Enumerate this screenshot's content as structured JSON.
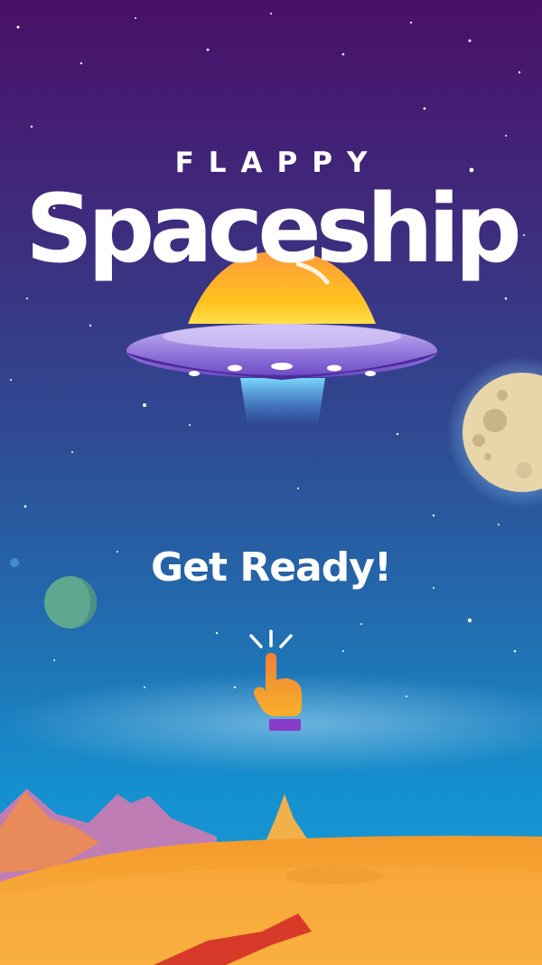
{
  "title": {
    "small": "FLAPPY",
    "big": "Spaceship"
  },
  "prompt": {
    "text": "Get Ready!"
  },
  "icons": {
    "spaceship": "ufo-icon",
    "tap": "tap-hand-icon",
    "moon": "moon-icon",
    "planet": "planet-icon"
  },
  "colors": {
    "sky_top": "#4a1068",
    "sky_bottom": "#18a0d6",
    "ufo_dome": "#ffb020",
    "ufo_body": "#8a6ad8",
    "beam": "#58d0ff",
    "ground": "#f8a030",
    "hand": "#f39628",
    "hand_cuff": "#8a3bc8"
  }
}
